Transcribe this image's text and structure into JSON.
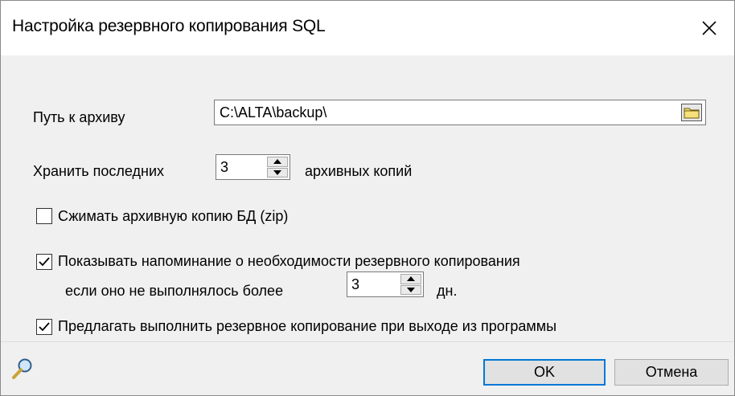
{
  "window": {
    "title": "Настройка резервного копирования SQL"
  },
  "path": {
    "label": "Путь к архиву",
    "value": "C:\\ALTA\\backup\\"
  },
  "keep": {
    "label_before": "Хранить последних",
    "value": "3",
    "label_after": "архивных копий"
  },
  "compress": {
    "label": "Сжимать архивную копию БД (zip)",
    "checked": false
  },
  "reminder": {
    "label": "Показывать напоминание о необходимости резервного копирования",
    "sub_label_before": "если оно не выполнялось более",
    "value": "3",
    "sub_label_after": "дн.",
    "checked": true
  },
  "on_exit": {
    "label": "Предлагать выполнить резервное копирование при выходе из программы",
    "checked": true
  },
  "buttons": {
    "ok": "OK",
    "cancel": "Отмена"
  },
  "icons": {
    "close": "close-icon",
    "folder": "folder-icon",
    "spin_up": "chevron-up-icon",
    "spin_down": "chevron-down-icon",
    "search": "search-icon",
    "check": "checkmark-icon"
  },
  "colors": {
    "default_button_border": "#0078d7",
    "dialog_background": "#f0f0f0",
    "titlebar_background": "#ffffff"
  }
}
